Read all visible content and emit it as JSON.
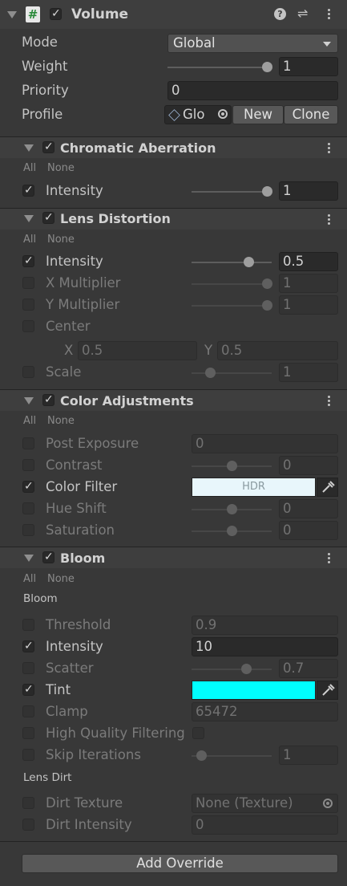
{
  "volume": {
    "title": "Volume",
    "help_glyph": "?",
    "settings_glyph": "⇌",
    "mode_label": "Mode",
    "mode_value": "Global",
    "weight_label": "Weight",
    "weight_value": "1",
    "weight_level": 1.0,
    "priority_label": "Priority",
    "priority_value": "0",
    "profile_label": "Profile",
    "profile_value": "Glo",
    "new_button": "New",
    "clone_button": "Clone"
  },
  "all_label": "All",
  "none_label": "None",
  "chromatic": {
    "title": "Chromatic Aberration",
    "intensity_label": "Intensity",
    "intensity_value": "1",
    "intensity_level": 1.0
  },
  "lens": {
    "title": "Lens Distortion",
    "intensity_label": "Intensity",
    "intensity_value": "0.5",
    "intensity_level": 0.75,
    "xmult_label": "X Multiplier",
    "xmult_value": "1",
    "ymult_label": "Y Multiplier",
    "ymult_value": "1",
    "center_label": "Center",
    "center_x_label": "X",
    "center_x_value": "0.5",
    "center_y_label": "Y",
    "center_y_value": "0.5",
    "scale_label": "Scale",
    "scale_value": "1"
  },
  "color": {
    "title": "Color Adjustments",
    "post_exposure_label": "Post Exposure",
    "post_exposure_value": "0",
    "contrast_label": "Contrast",
    "contrast_value": "0",
    "color_filter_label": "Color Filter",
    "color_filter_text": "HDR",
    "color_filter_swatch": "#e8f6fb",
    "hue_shift_label": "Hue Shift",
    "hue_shift_value": "0",
    "saturation_label": "Saturation",
    "saturation_value": "0"
  },
  "bloom": {
    "title": "Bloom",
    "group_bloom": "Bloom",
    "threshold_label": "Threshold",
    "threshold_value": "0.9",
    "intensity_label": "Intensity",
    "intensity_value": "10",
    "scatter_label": "Scatter",
    "scatter_value": "0.7",
    "tint_label": "Tint",
    "tint_swatch": "#00ffff",
    "clamp_label": "Clamp",
    "clamp_value": "65472",
    "hq_label": "High Quality Filtering",
    "skip_label": "Skip Iterations",
    "skip_value": "1",
    "group_lens_dirt": "Lens Dirt",
    "dirt_texture_label": "Dirt Texture",
    "dirt_texture_value": "None (Texture)",
    "dirt_intensity_label": "Dirt Intensity",
    "dirt_intensity_value": "0"
  },
  "add_override": "Add Override",
  "colors": {
    "background": "#383838",
    "header": "#3e3e3e",
    "field": "#2a2a2a",
    "button": "#585858"
  }
}
